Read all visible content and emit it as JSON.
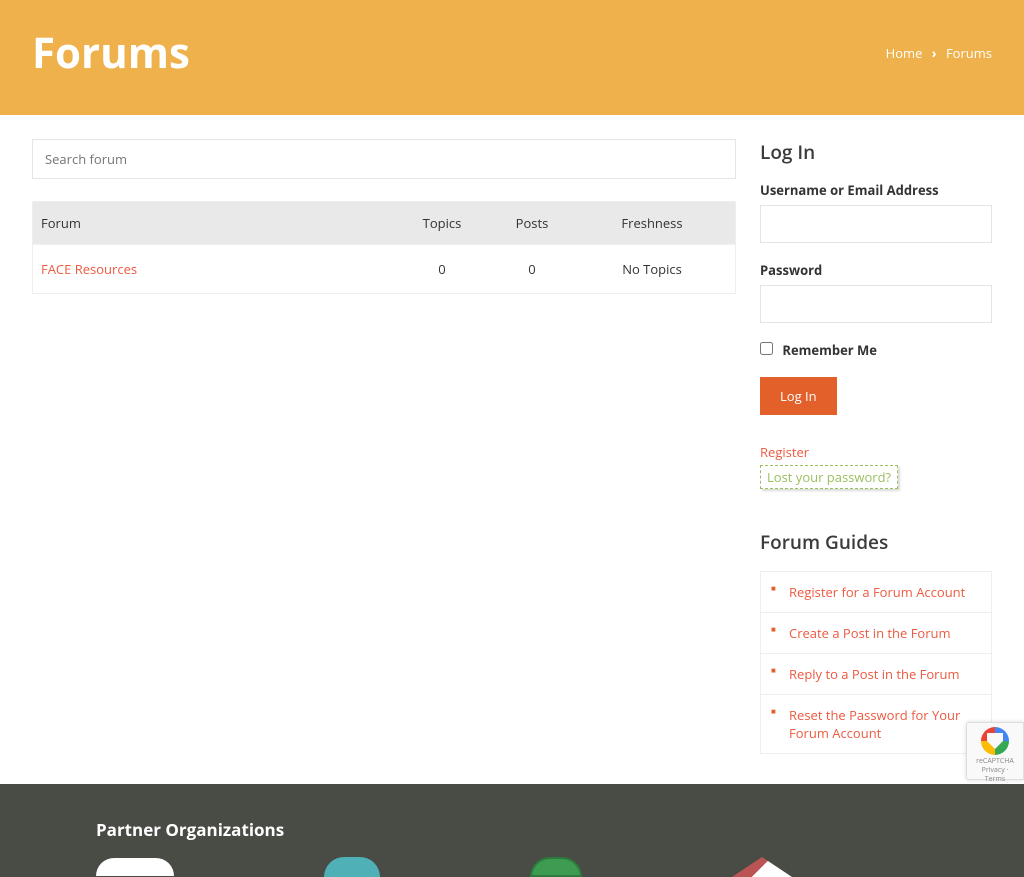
{
  "header": {
    "title": "Forums",
    "breadcrumb_home": "Home",
    "breadcrumb_current": "Forums"
  },
  "search": {
    "placeholder": "Search forum"
  },
  "table": {
    "cols": {
      "forum": "Forum",
      "topics": "Topics",
      "posts": "Posts",
      "fresh": "Freshness"
    },
    "rows": [
      {
        "name": "FACE Resources",
        "topics": "0",
        "posts": "0",
        "fresh": "No Topics"
      }
    ]
  },
  "login": {
    "title": "Log In",
    "label_user": "Username or Email Address",
    "label_pass": "Password",
    "remember": "Remember Me",
    "button": "Log In",
    "register": "Register",
    "lost": "Lost your password?"
  },
  "guides": {
    "title": "Forum Guides",
    "items": [
      "Register for a Forum Account",
      "Create a Post in the Forum",
      "Reply to a Post in the Forum",
      "Reset the Password for Your Forum Account"
    ]
  },
  "footer": {
    "partners_title": "Partner Organizations"
  },
  "recaptcha": {
    "line1": "reCAPTCHA",
    "line2": "Privacy · Terms"
  }
}
